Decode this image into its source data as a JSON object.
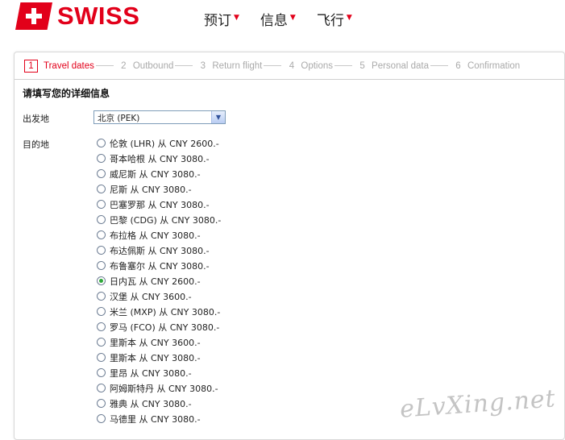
{
  "brand": {
    "name": "SWISS",
    "color": "#e2001a"
  },
  "nav": {
    "items": [
      {
        "label": "预订"
      },
      {
        "label": "信息"
      },
      {
        "label": "飞行"
      }
    ]
  },
  "steps": [
    {
      "num": "1",
      "label": "Travel dates",
      "active": true
    },
    {
      "num": "2",
      "label": "Outbound"
    },
    {
      "num": "3",
      "label": "Return flight"
    },
    {
      "num": "4",
      "label": "Options"
    },
    {
      "num": "5",
      "label": "Personal data"
    },
    {
      "num": "6",
      "label": "Confirmation"
    }
  ],
  "form": {
    "title": "请填写您的详细信息",
    "origin_label": "出发地",
    "origin_value": "北京 (PEK)",
    "destination_label": "目的地",
    "destinations": [
      {
        "label": "伦敦 (LHR) 从 CNY 2600.-"
      },
      {
        "label": "哥本哈根 从 CNY 3080.-"
      },
      {
        "label": "威尼斯 从 CNY 3080.-"
      },
      {
        "label": "尼斯 从 CNY 3080.-"
      },
      {
        "label": "巴塞罗那 从 CNY 3080.-"
      },
      {
        "label": "巴黎 (CDG) 从 CNY 3080.-"
      },
      {
        "label": "布拉格 从 CNY 3080.-"
      },
      {
        "label": "布达佩斯 从 CNY 3080.-"
      },
      {
        "label": "布鲁塞尔 从 CNY 3080.-"
      },
      {
        "label": "日内瓦 从 CNY 2600.-",
        "checked": true
      },
      {
        "label": "汉堡 从 CNY 3600.-"
      },
      {
        "label": "米兰 (MXP) 从 CNY 3080.-"
      },
      {
        "label": "罗马 (FCO) 从 CNY 3080.-"
      },
      {
        "label": "里斯本 从 CNY 3600.-"
      },
      {
        "label": "里斯本 从 CNY 3080.-"
      },
      {
        "label": "里昂 从 CNY 3080.-"
      },
      {
        "label": "阿姆斯特丹 从 CNY 3080.-"
      },
      {
        "label": "雅典 从 CNY 3080.-"
      },
      {
        "label": "马德里 从 CNY 3080.-"
      }
    ]
  },
  "watermark": "eLvXing.net"
}
